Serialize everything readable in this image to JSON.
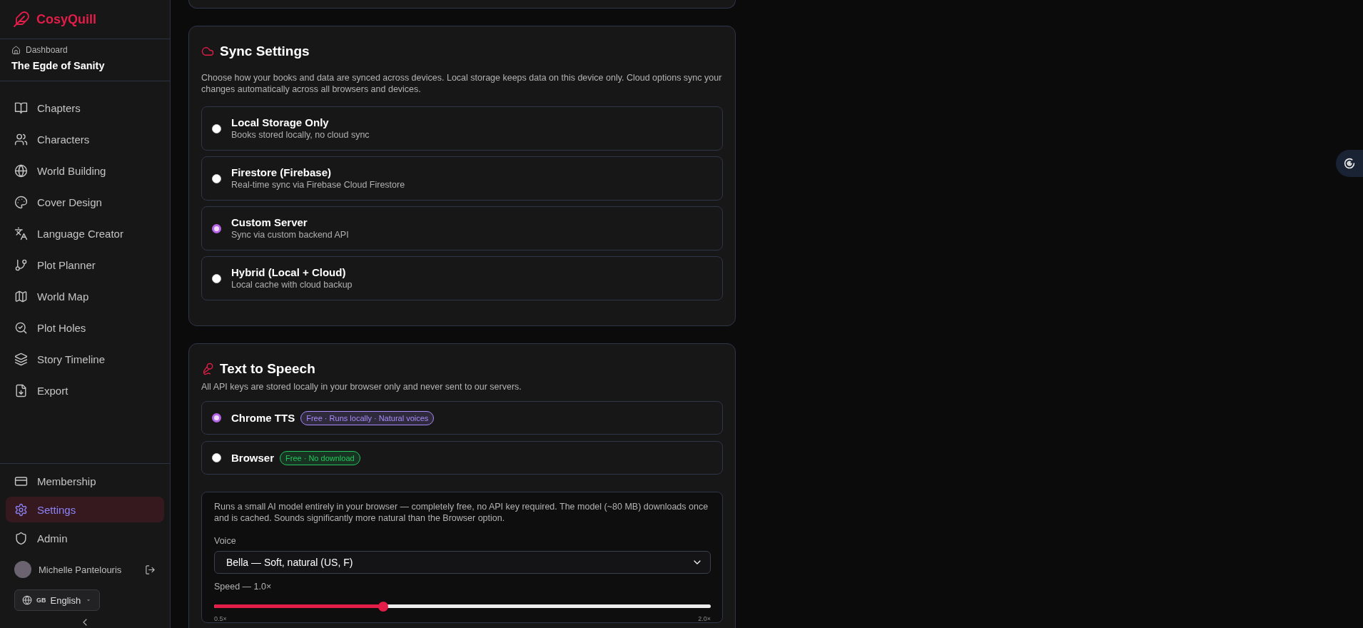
{
  "brand": {
    "name": "CosyQuill"
  },
  "sidebar": {
    "breadcrumb": "Dashboard",
    "book_title": "The Egde of Sanity",
    "items": [
      {
        "label": "Chapters",
        "selected": false
      },
      {
        "label": "Characters",
        "selected": false
      },
      {
        "label": "World Building",
        "selected": false
      },
      {
        "label": "Cover Design",
        "selected": false
      },
      {
        "label": "Language Creator",
        "selected": false
      },
      {
        "label": "Plot Planner",
        "selected": false
      },
      {
        "label": "World Map",
        "selected": false
      },
      {
        "label": "Plot Holes",
        "selected": false
      },
      {
        "label": "Story Timeline",
        "selected": false
      },
      {
        "label": "Export",
        "selected": false
      }
    ],
    "bottom_items": [
      {
        "label": "Membership",
        "selected": false
      },
      {
        "label": "Settings",
        "selected": true
      },
      {
        "label": "Admin",
        "selected": false
      }
    ],
    "user": {
      "name": "Michelle Pantelouris"
    },
    "language": {
      "flag": "GB",
      "label": "English"
    }
  },
  "sync": {
    "title": "Sync Settings",
    "description": "Choose how your books and data are synced across devices. Local storage keeps data on this device only. Cloud options sync your changes automatically across all browsers and devices.",
    "options": [
      {
        "title": "Local Storage Only",
        "subtitle": "Books stored locally, no cloud sync",
        "selected": false
      },
      {
        "title": "Firestore (Firebase)",
        "subtitle": "Real-time sync via Firebase Cloud Firestore",
        "selected": false
      },
      {
        "title": "Custom Server",
        "subtitle": "Sync via custom backend API",
        "selected": true
      },
      {
        "title": "Hybrid (Local + Cloud)",
        "subtitle": "Local cache with cloud backup",
        "selected": false
      }
    ]
  },
  "tts": {
    "title": "Text to Speech",
    "description": "All API keys are stored locally in your browser only and never sent to our servers.",
    "options": [
      {
        "title": "Chrome TTS",
        "badge": "Free · Runs locally · Natural voices",
        "color": "#a78bfa",
        "selected": true
      },
      {
        "title": "Browser",
        "badge": "Free · No download",
        "color": "#22c55e",
        "selected": false
      }
    ],
    "panel": {
      "description": "Runs a small AI model entirely in your browser — completely free, no API key required. The model (~80 MB) downloads once and is cached. Sounds significantly more natural than the Browser option.",
      "voice_label": "Voice",
      "voice": "Bella — Soft, natural (US, F)",
      "speed_label": "Speed — 1.0×",
      "speed": {
        "level": 0.34
      },
      "min_label": "0.5×",
      "max_label": "2.0×"
    }
  }
}
